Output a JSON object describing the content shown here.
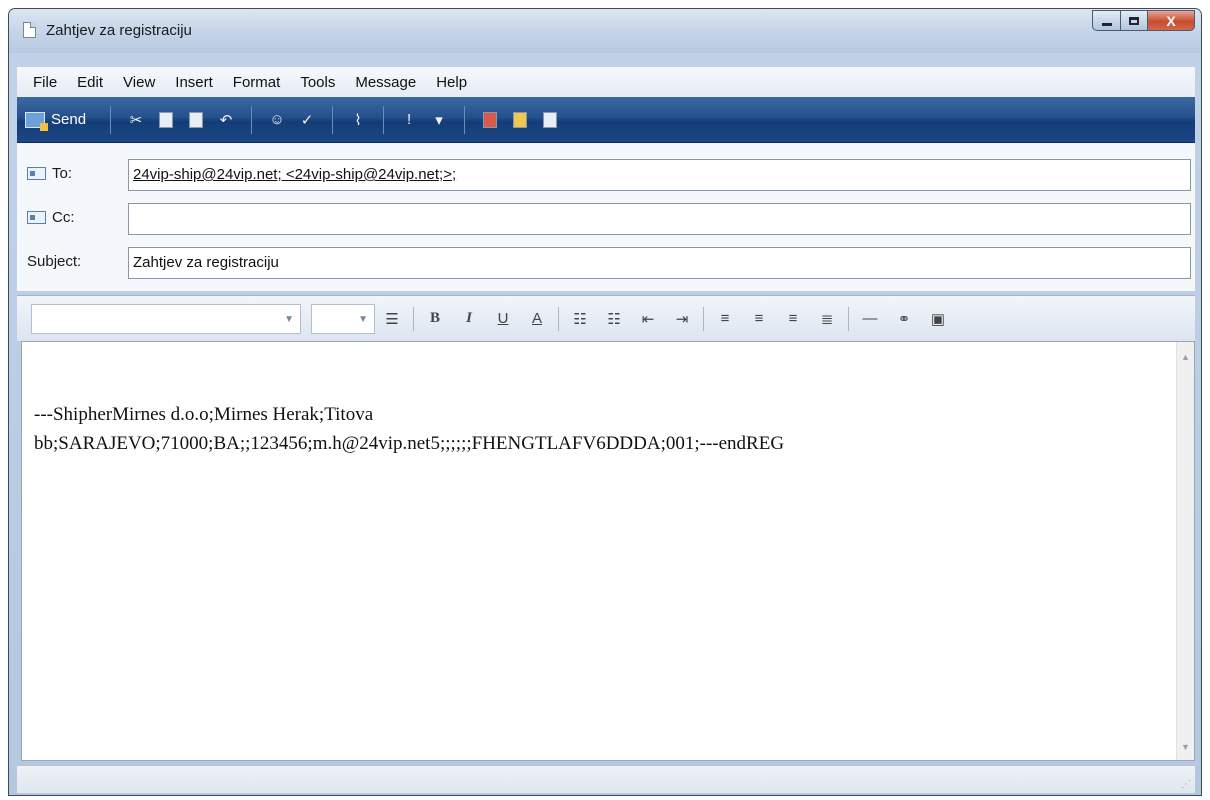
{
  "window": {
    "title": "Zahtjev za registraciju",
    "controls": {
      "minimize": "minimize",
      "maximize": "maximize",
      "close": "X"
    }
  },
  "menu": [
    "File",
    "Edit",
    "View",
    "Insert",
    "Format",
    "Tools",
    "Message",
    "Help"
  ],
  "toolbar": {
    "send_label": "Send",
    "icons": [
      "cut-icon",
      "copy-icon",
      "paste-icon",
      "undo-icon",
      "check-names-icon",
      "spelling-icon",
      "attach-icon",
      "priority-icon",
      "sign-icon",
      "encrypt-icon",
      "work-offline-icon"
    ]
  },
  "fields": {
    "to_label": "To:",
    "to_value": "24vip-ship@24vip.net; <24vip-ship@24vip.net;>;",
    "cc_label": "Cc:",
    "cc_value": "",
    "subject_label": "Subject:",
    "subject_value": "Zahtjev za registraciju"
  },
  "format_bar": {
    "font_name": "",
    "font_size": "",
    "bold": "B",
    "italic": "I",
    "underline": "U",
    "font_color": "A"
  },
  "message_body": {
    "line1": "---ShipherMirnes d.o.o;Mirnes Herak;Titova",
    "line2": "bb;SARAJEVO;71000;BA;;123456;m.h@24vip.net5;;;;;;FHENGTLAFV6DDDA;001;---endREG"
  },
  "colors": {
    "toolbar": "#24508c",
    "titlebar": "#c6d5e8",
    "close_button": "#c74c31"
  }
}
